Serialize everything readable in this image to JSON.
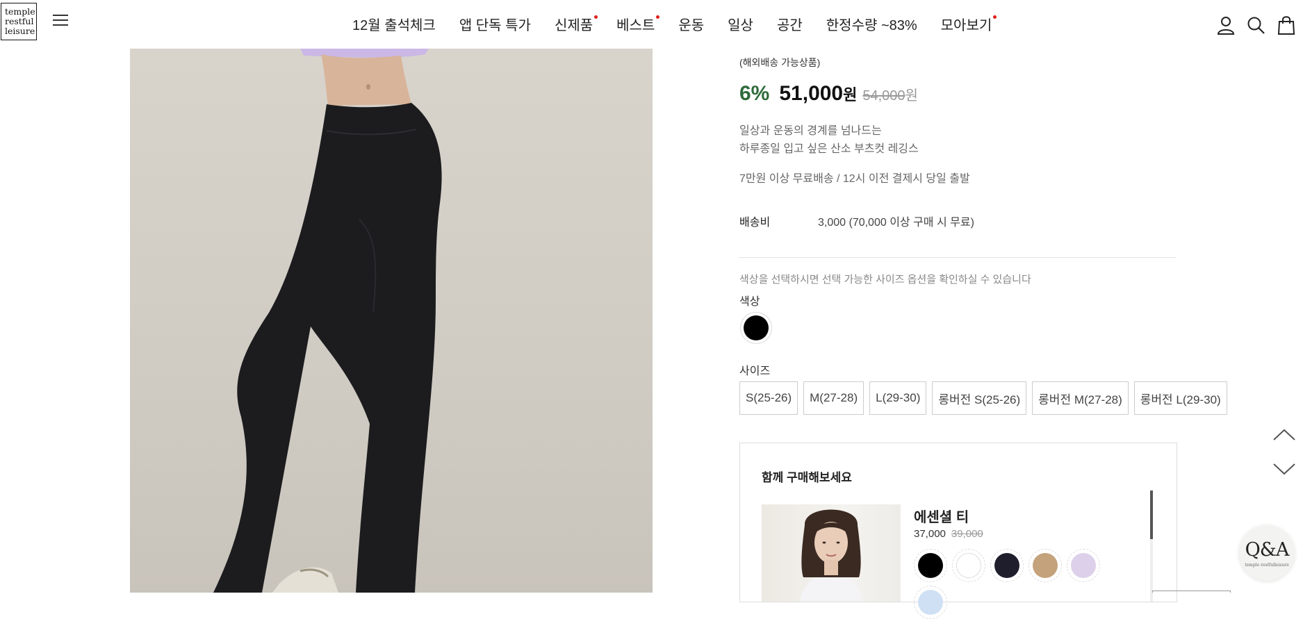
{
  "brand": {
    "logo_lines": [
      "temple",
      "restful",
      "leisure"
    ]
  },
  "nav": {
    "items": [
      {
        "label": "12월 출석체크",
        "dot": false
      },
      {
        "label": "앱 단독 특가",
        "dot": false
      },
      {
        "label": "신제품",
        "dot": true
      },
      {
        "label": "베스트",
        "dot": true
      },
      {
        "label": "운동",
        "dot": false
      },
      {
        "label": "일상",
        "dot": false
      },
      {
        "label": "공간",
        "dot": false
      },
      {
        "label": "한정수량 ~83%",
        "dot": false
      },
      {
        "label": "모아보기",
        "dot": true
      }
    ],
    "icons": [
      "user-icon",
      "search-icon",
      "shopping-bag-icon"
    ],
    "dot_color": "#e0201b"
  },
  "product": {
    "overseas_note": "(해외배송 가능상품)",
    "discount": "6%",
    "price": "51,000",
    "price_unit": "원",
    "original_price": "54,000",
    "original_unit": "원",
    "description_lines": [
      "일상과 운동의 경계를 넘나드는",
      "하루종일 입고 싶은 산소 부츠컷 레깅스"
    ],
    "shipping_note": "7만원 이상 무료배송 / 12시 이전 결제시 당일 출발",
    "shipping_fee_label": "배송비",
    "shipping_fee_value": "3,000 (70,000 이상 구매 시 무료)",
    "option_hint": "색상을 선택하시면 선택 가능한 사이즈 옵션을 확인하실 수 있습니다",
    "color_label": "색상",
    "colors": [
      "#000000"
    ],
    "size_label": "사이즈",
    "sizes": [
      "S(25-26)",
      "M(27-28)",
      "L(29-30)",
      "롱버전 S(25-26)",
      "롱버전 M(27-28)",
      "롱버전 L(29-30)"
    ],
    "discount_color": "#2e6b3a"
  },
  "together": {
    "title": "함께 구매해보세요",
    "item": {
      "name": "에센셜 티",
      "price": "37,000",
      "original_price": "39,000",
      "swatches": [
        "#000000",
        "#ffffff",
        "#1e1e2c",
        "#c4a27c",
        "#ddd0ea",
        "#cfe0f4"
      ]
    }
  },
  "floating": {
    "qna_label": "Q&A",
    "qna_sub": "temple restfulleisure"
  }
}
